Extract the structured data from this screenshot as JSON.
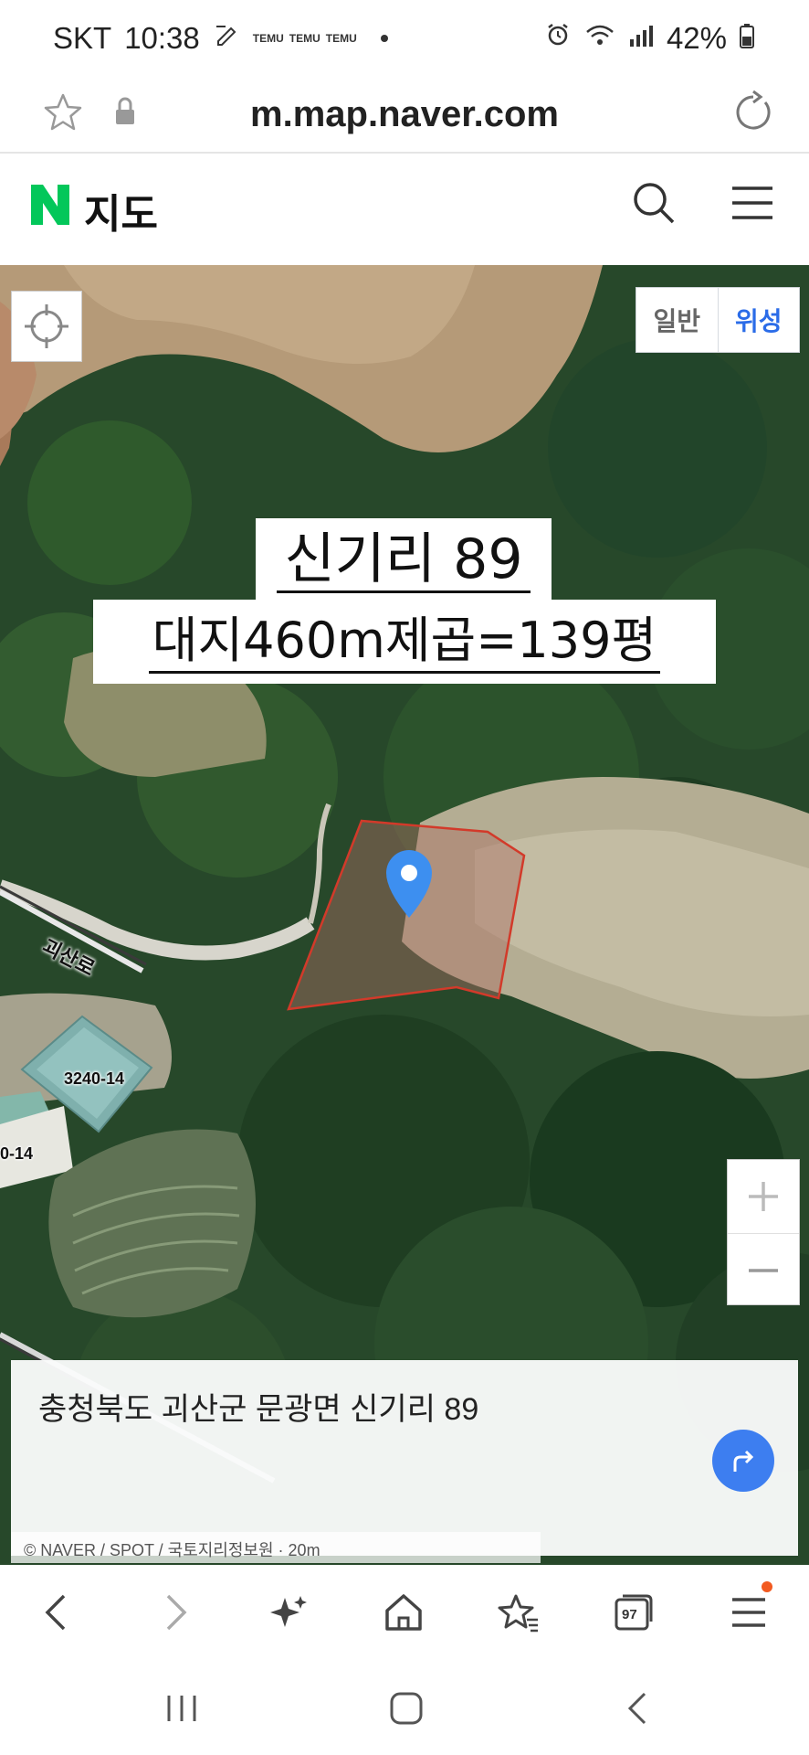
{
  "status_bar": {
    "carrier": "SKT",
    "time": "10:38",
    "notif_apps": [
      "TEMU",
      "TEMU",
      "TEMU"
    ],
    "battery": "42%"
  },
  "url_bar": {
    "url": "m.map.naver.com"
  },
  "header": {
    "logo": "N",
    "title": "지도"
  },
  "map": {
    "map_type_options": [
      "일반",
      "위성"
    ],
    "selected_map_type": "위성",
    "annotation_line1": "신기리 89",
    "annotation_line2": "대지460m제곱=139평",
    "road_label": "괴산로",
    "parcel_labels": [
      "3240-14",
      "0-14"
    ],
    "zoom_in": "+",
    "zoom_out": "−",
    "copyright": "© NAVER / SPOT / 국토지리정보원 · 20m"
  },
  "address_card": {
    "address": "충청북도 괴산군 문광면 신기리 89"
  },
  "toolbar": {
    "tab_count": "97"
  },
  "colors": {
    "naver_green": "#03C75A",
    "accent_blue": "#2b6ce8",
    "pin_blue": "#3d8ff0",
    "parcel_outline": "#d23a2a"
  }
}
